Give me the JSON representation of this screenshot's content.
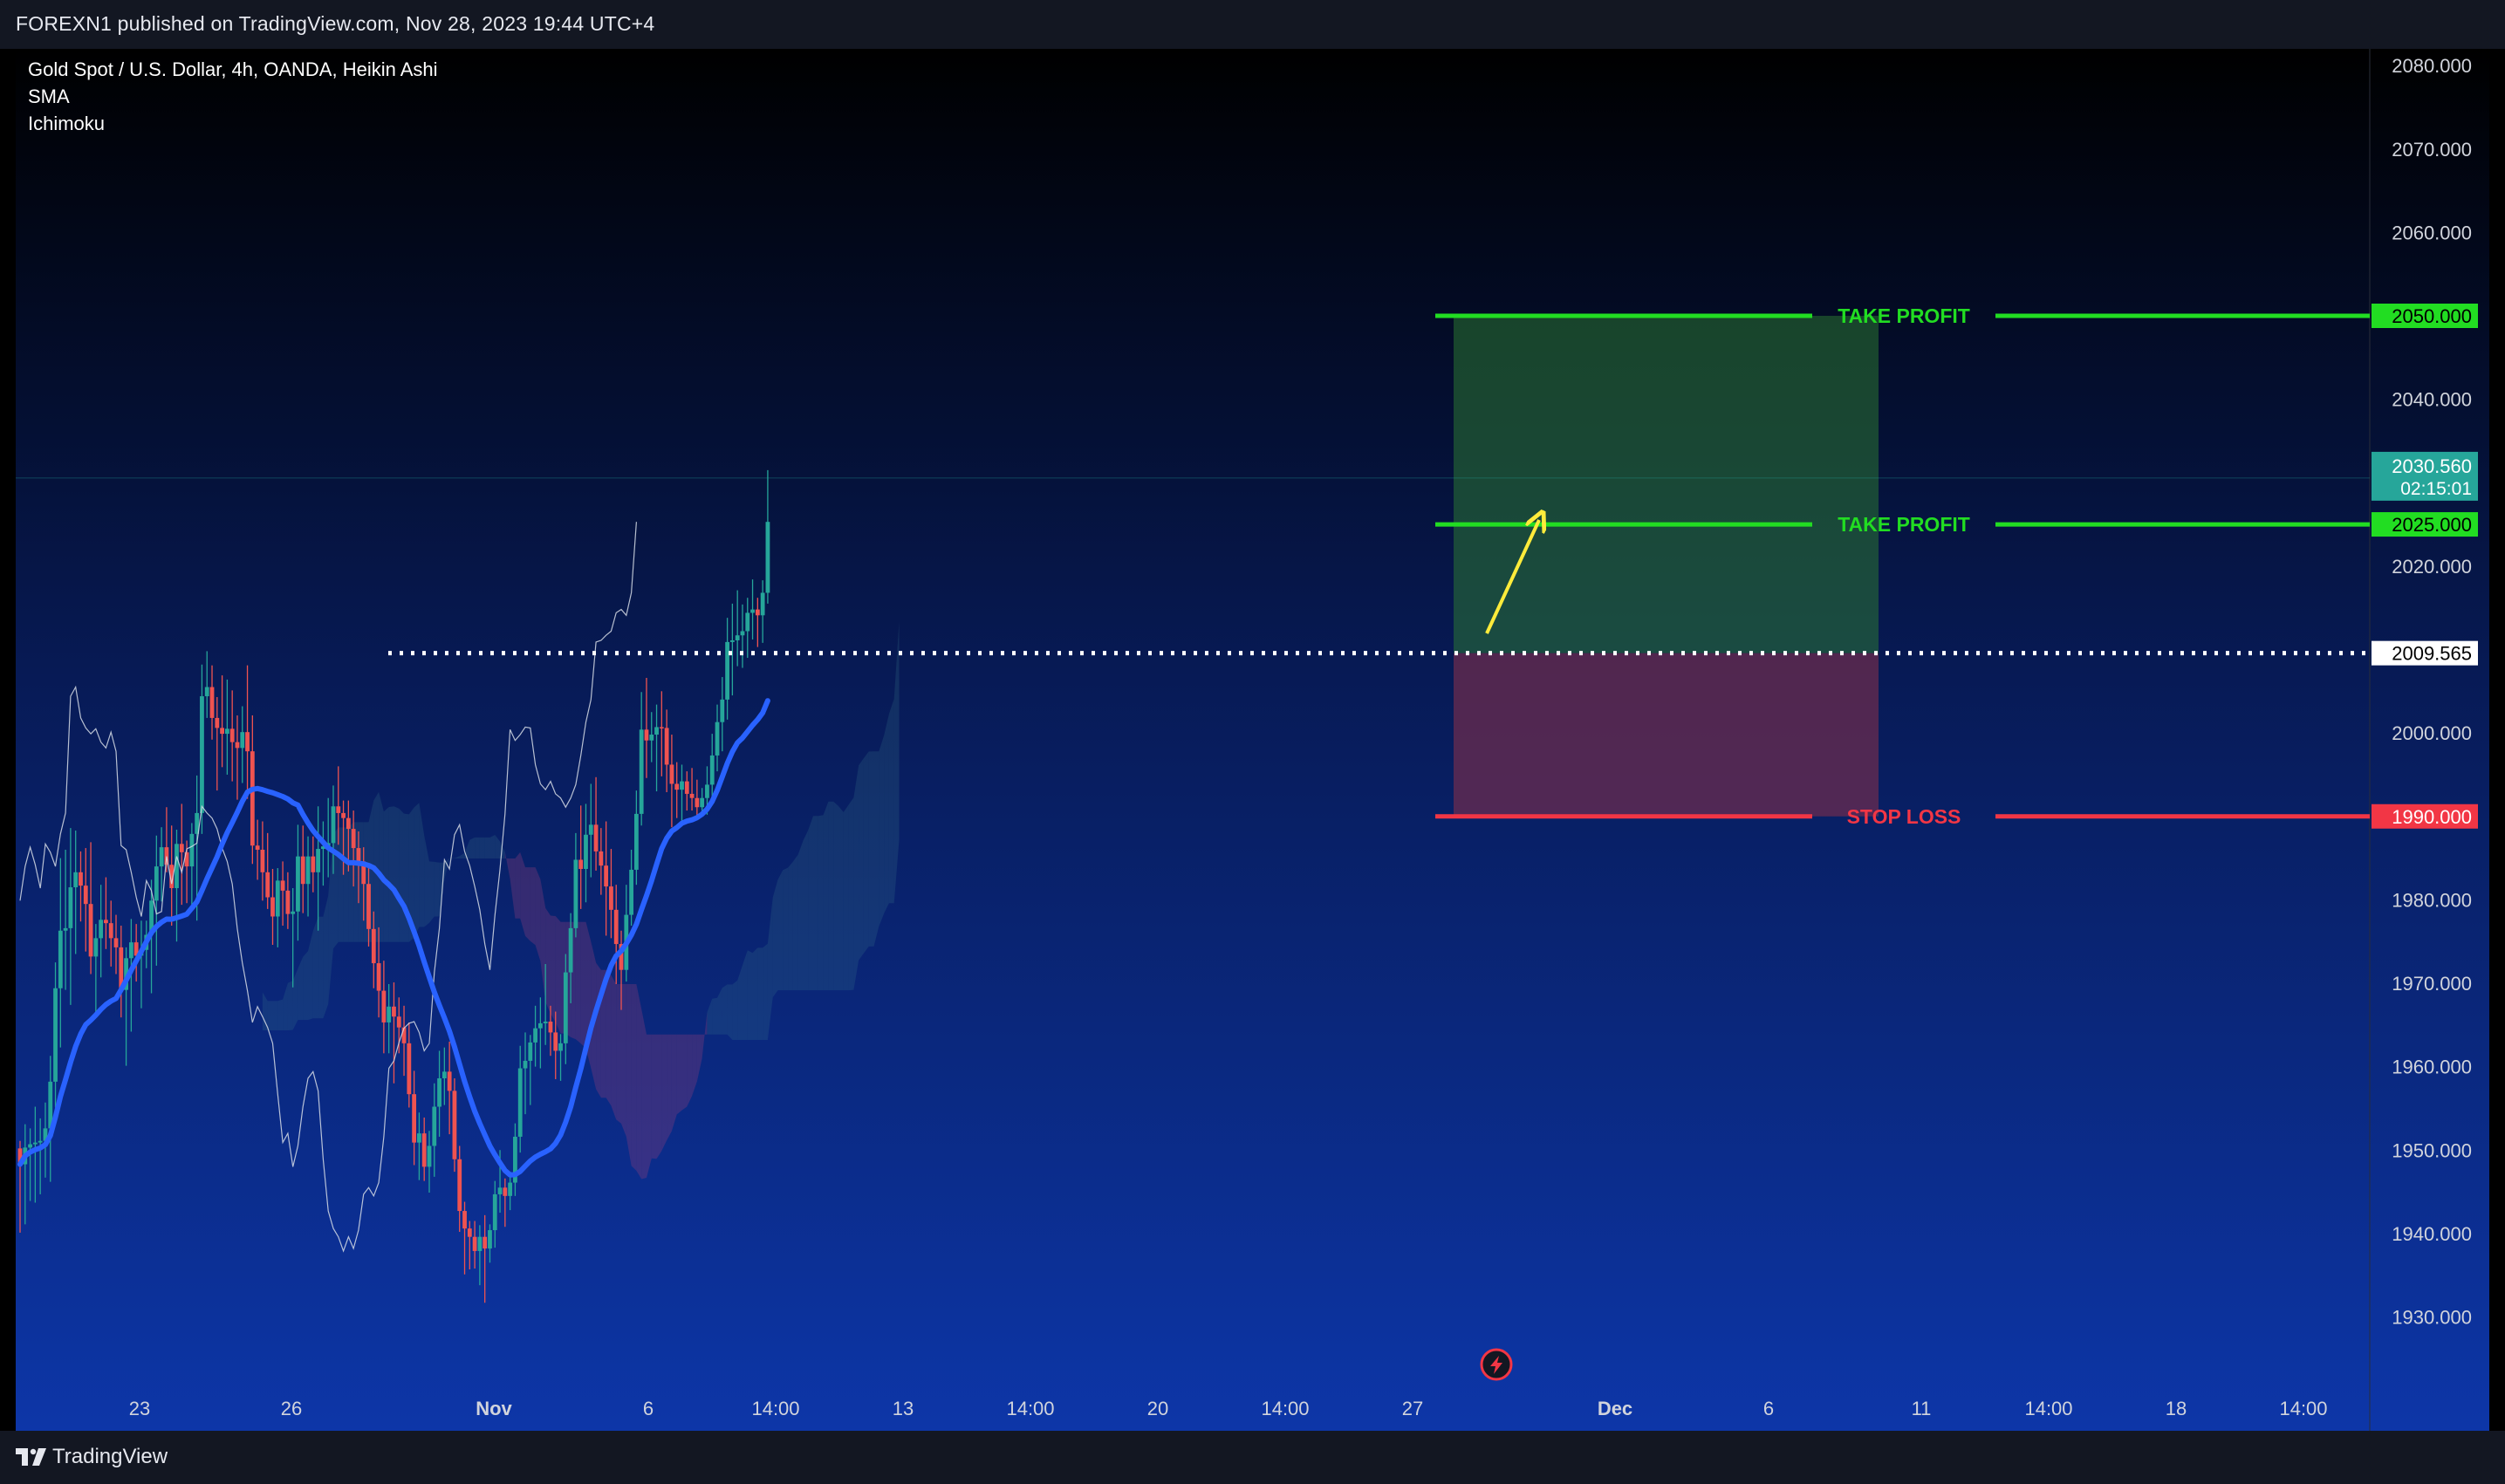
{
  "header": {
    "text": "FOREXN1 published on TradingView.com, Nov 28, 2023 19:44 UTC+4"
  },
  "footer": {
    "brand": "TradingView"
  },
  "legend": {
    "symbol": "Gold Spot / U.S. Dollar, 4h, OANDA, Heikin Ashi",
    "indicator_1": "SMA",
    "indicator_2": "Ichimoku"
  },
  "colors": {
    "background_top": "#000000",
    "background_bottom": "#0d34a6",
    "up_candle": "#26a69a",
    "down_candle": "#ef5350",
    "sma_line": "#2962ff",
    "ichimoku_line": "#d7dde6",
    "take_profit": "#22dd22",
    "stop_loss": "#f23645",
    "profit_zone": "#2e7d32",
    "loss_zone": "#7a2e4d",
    "arrow": "#ffeb3b",
    "entry_line": "#ffffff"
  },
  "chart_data": {
    "type": "candlestick",
    "ylim": [
      1922,
      2082
    ],
    "y_ticks": [
      "2080.000",
      "2070.000",
      "2060.000",
      "2050.000",
      "2040.000",
      "2030.000",
      "2020.000",
      "2010.000",
      "2000.000",
      "1990.000",
      "1980.000",
      "1970.000",
      "1960.000",
      "1950.000",
      "1940.000",
      "1930.000"
    ],
    "x_ticks": [
      "23",
      "26",
      "Nov",
      "6",
      "14:00",
      "13",
      "14:00",
      "20",
      "14:00",
      "27",
      "Dec",
      "6",
      "11",
      "14:00",
      "18",
      "14:00"
    ],
    "price_levels": [
      {
        "label": "TAKE PROFIT",
        "value": 2050.0,
        "display": "2050.000",
        "kind": "take_profit"
      },
      {
        "label": "TAKE PROFIT",
        "value": 2025.0,
        "display": "2025.000",
        "kind": "take_profit"
      },
      {
        "label": "",
        "value": 2009.565,
        "display": "2009.565",
        "kind": "entry"
      },
      {
        "label": "STOP LOSS",
        "value": 1990.0,
        "display": "1990.000",
        "kind": "stop_loss"
      }
    ],
    "current_price": {
      "value": 2030.56,
      "display": "2030.560",
      "countdown": "02:15:01"
    },
    "ohlc": [
      [
        1950.2,
        1951.1,
        1940.1,
        1948.3
      ],
      [
        1948.3,
        1953.1,
        1941.1,
        1950.3
      ],
      [
        1950.3,
        1952.6,
        1943.9,
        1950.7
      ],
      [
        1950.7,
        1955.2,
        1943.7,
        1950.9
      ],
      [
        1950.9,
        1953.8,
        1944.7,
        1951.1
      ],
      [
        1951.1,
        1955.7,
        1946.7,
        1952.6
      ],
      [
        1952.6,
        1961.3,
        1946.2,
        1958.2
      ],
      [
        1958.2,
        1972.5,
        1955.1,
        1969.4
      ],
      [
        1969.4,
        1985.0,
        1962.3,
        1976.3
      ],
      [
        1976.3,
        1986.0,
        1969.2,
        1976.6
      ],
      [
        1976.6,
        1988.6,
        1967.4,
        1981.5
      ],
      [
        1981.5,
        1988.3,
        1973.5,
        1983.3
      ],
      [
        1983.3,
        1985.8,
        1977.4,
        1981.7
      ],
      [
        1981.7,
        1986.2,
        1973.8,
        1979.5
      ],
      [
        1979.5,
        1986.9,
        1971.1,
        1973.2
      ],
      [
        1973.2,
        1977.1,
        1966.2,
        1975.4
      ],
      [
        1975.4,
        1981.8,
        1970.7,
        1977.6
      ],
      [
        1977.6,
        1982.7,
        1974.1,
        1977.2
      ],
      [
        1977.2,
        1979.9,
        1972.0,
        1975.4
      ],
      [
        1975.4,
        1978.2,
        1971.1,
        1974.3
      ],
      [
        1974.3,
        1976.9,
        1965.9,
        1969.2
      ],
      [
        1969.2,
        1974.3,
        1960.1,
        1973.0
      ],
      [
        1973.0,
        1977.7,
        1964.2,
        1974.9
      ],
      [
        1974.9,
        1977.1,
        1970.2,
        1973.3
      ],
      [
        1973.3,
        1977.5,
        1967.0,
        1974.0
      ],
      [
        1974.0,
        1977.5,
        1971.8,
        1975.8
      ],
      [
        1975.8,
        1982.4,
        1968.8,
        1979.9
      ],
      [
        1979.9,
        1987.7,
        1972.1,
        1984.0
      ],
      [
        1984.0,
        1988.7,
        1979.8,
        1986.3
      ],
      [
        1986.3,
        1991.1,
        1983.3,
        1984.2
      ],
      [
        1984.2,
        1988.9,
        1976.9,
        1981.4
      ],
      [
        1981.4,
        1988.4,
        1975.0,
        1986.7
      ],
      [
        1986.7,
        1991.5,
        1979.4,
        1985.7
      ],
      [
        1985.7,
        1987.1,
        1979.6,
        1984.0
      ],
      [
        1984.0,
        1989.2,
        1979.2,
        1987.9
      ],
      [
        1987.9,
        1994.9,
        1977.5,
        1990.4
      ],
      [
        1990.4,
        2008.2,
        1987.9,
        2004.4
      ],
      [
        2004.4,
        2009.8,
        2001.8,
        2005.5
      ],
      [
        2005.5,
        2008.1,
        1999.2,
        2001.8
      ],
      [
        2001.8,
        2004.3,
        1993.1,
        2000.6
      ],
      [
        2000.6,
        2006.9,
        1995.9,
        1999.9
      ],
      [
        1999.9,
        2006.4,
        1995.0,
        2000.5
      ],
      [
        2000.5,
        2005.1,
        1994.2,
        1998.9
      ],
      [
        1998.9,
        2002.1,
        1992.0,
        1998.2
      ],
      [
        1998.2,
        2003.2,
        1994.0,
        2000.1
      ],
      [
        2000.1,
        2008.1,
        1992.1,
        1997.8
      ],
      [
        1997.8,
        2002.1,
        1984.3,
        1986.5
      ],
      [
        1986.5,
        1989.6,
        1982.4,
        1986.0
      ],
      [
        1986.0,
        1989.4,
        1979.9,
        1983.3
      ],
      [
        1983.3,
        1988.0,
        1978.9,
        1980.3
      ],
      [
        1980.3,
        1983.7,
        1974.6,
        1978.0
      ],
      [
        1978.0,
        1983.8,
        1974.3,
        1982.3
      ],
      [
        1982.3,
        1984.6,
        1976.9,
        1981.1
      ],
      [
        1981.1,
        1983.3,
        1976.5,
        1978.3
      ],
      [
        1978.3,
        1981.4,
        1969.5,
        1978.6
      ],
      [
        1978.6,
        1989.0,
        1975.1,
        1985.2
      ],
      [
        1985.2,
        1988.9,
        1978.4,
        1981.9
      ],
      [
        1981.9,
        1987.6,
        1978.0,
        1985.2
      ],
      [
        1985.2,
        1987.6,
        1980.9,
        1983.3
      ],
      [
        1983.3,
        1991.2,
        1976.3,
        1986.1
      ],
      [
        1986.1,
        1989.4,
        1981.7,
        1986.4
      ],
      [
        1986.4,
        1992.2,
        1982.7,
        1986.8
      ],
      [
        1986.8,
        1993.7,
        1983.1,
        1991.2
      ],
      [
        1991.2,
        1996.0,
        1986.6,
        1990.4
      ],
      [
        1990.4,
        1991.9,
        1983.0,
        1989.8
      ],
      [
        1989.8,
        1991.9,
        1983.4,
        1988.5
      ],
      [
        1988.5,
        1990.7,
        1981.6,
        1986.2
      ],
      [
        1986.2,
        1988.2,
        1979.6,
        1984.6
      ],
      [
        1984.6,
        1986.3,
        1977.5,
        1981.9
      ],
      [
        1981.9,
        1984.4,
        1974.4,
        1976.5
      ],
      [
        1976.5,
        1978.6,
        1969.4,
        1972.4
      ],
      [
        1972.4,
        1976.7,
        1965.9,
        1969.1
      ],
      [
        1969.1,
        1972.7,
        1961.6,
        1965.3
      ],
      [
        1965.3,
        1969.9,
        1961.6,
        1967.2
      ],
      [
        1967.2,
        1970.1,
        1958.0,
        1966.0
      ],
      [
        1966.0,
        1968.3,
        1961.6,
        1964.7
      ],
      [
        1964.7,
        1967.3,
        1958.9,
        1962.8
      ],
      [
        1962.8,
        1965.3,
        1955.1,
        1956.7
      ],
      [
        1956.7,
        1959.5,
        1948.2,
        1950.9
      ],
      [
        1950.9,
        1954.5,
        1946.4,
        1952.0
      ],
      [
        1952.0,
        1953.9,
        1946.3,
        1948.0
      ],
      [
        1948.0,
        1952.3,
        1944.9,
        1950.5
      ],
      [
        1950.5,
        1958.0,
        1946.8,
        1955.2
      ],
      [
        1955.2,
        1961.9,
        1951.6,
        1958.6
      ],
      [
        1958.6,
        1962.3,
        1955.4,
        1959.4
      ],
      [
        1959.4,
        1963.0,
        1951.9,
        1957.1
      ],
      [
        1957.1,
        1958.6,
        1947.4,
        1948.9
      ],
      [
        1948.9,
        1950.5,
        1940.2,
        1942.7
      ],
      [
        1942.7,
        1943.8,
        1935.1,
        1940.6
      ],
      [
        1940.6,
        1941.5,
        1935.7,
        1939.6
      ],
      [
        1939.6,
        1941.5,
        1935.8,
        1937.9
      ],
      [
        1937.9,
        1941.0,
        1933.8,
        1939.6
      ],
      [
        1939.6,
        1942.2,
        1931.7,
        1938.2
      ],
      [
        1938.2,
        1941.1,
        1936.5,
        1940.4
      ],
      [
        1940.4,
        1946.3,
        1938.3,
        1944.7
      ],
      [
        1944.7,
        1950.0,
        1942.5,
        1945.5
      ],
      [
        1945.5,
        1946.6,
        1940.8,
        1944.5
      ],
      [
        1944.5,
        1947.4,
        1942.8,
        1946.1
      ],
      [
        1946.1,
        1953.2,
        1944.5,
        1951.6
      ],
      [
        1951.6,
        1962.5,
        1949.7,
        1959.8
      ],
      [
        1959.8,
        1964.1,
        1954.3,
        1960.7
      ],
      [
        1960.7,
        1963.8,
        1955.4,
        1962.9
      ],
      [
        1962.9,
        1967.3,
        1960.0,
        1964.6
      ],
      [
        1964.6,
        1968.3,
        1959.8,
        1965.2
      ],
      [
        1965.2,
        1972.3,
        1962.6,
        1965.4
      ],
      [
        1965.4,
        1967.3,
        1961.3,
        1964.1
      ],
      [
        1964.1,
        1966.6,
        1958.5,
        1961.9
      ],
      [
        1961.9,
        1963.9,
        1958.3,
        1962.8
      ],
      [
        1962.8,
        1973.5,
        1960.3,
        1971.3
      ],
      [
        1971.3,
        1978.4,
        1967.6,
        1976.6
      ],
      [
        1976.6,
        1988.0,
        1975.5,
        1984.8
      ],
      [
        1984.8,
        1991.3,
        1978.9,
        1983.7
      ],
      [
        1983.7,
        1991.5,
        1979.7,
        1987.8
      ],
      [
        1987.8,
        1993.9,
        1982.7,
        1989.0
      ],
      [
        1989.0,
        1994.7,
        1983.5,
        1985.8
      ],
      [
        1985.8,
        1988.6,
        1980.6,
        1984.1
      ],
      [
        1984.1,
        1989.4,
        1975.7,
        1981.6
      ],
      [
        1981.6,
        1986.1,
        1975.4,
        1978.8
      ],
      [
        1978.8,
        1981.8,
        1969.9,
        1974.7
      ],
      [
        1974.7,
        1976.3,
        1966.8,
        1971.6
      ],
      [
        1971.6,
        1981.8,
        1970.2,
        1978.2
      ],
      [
        1978.2,
        1986.0,
        1976.9,
        1983.6
      ],
      [
        1983.6,
        1993.1,
        1981.8,
        1990.3
      ],
      [
        1990.3,
        2004.9,
        1988.9,
        2000.4
      ],
      [
        2000.4,
        2006.6,
        1994.6,
        1999.1
      ],
      [
        1999.1,
        2002.5,
        1996.5,
        1999.8
      ],
      [
        1999.8,
        2003.4,
        1993.0,
        2000.7
      ],
      [
        2000.7,
        2005.0,
        1994.8,
        2000.6
      ],
      [
        2000.6,
        2002.8,
        1992.9,
        1996.2
      ],
      [
        1996.2,
        1999.8,
        1988.7,
        1993.9
      ],
      [
        1993.9,
        1996.5,
        1989.8,
        1993.2
      ],
      [
        1993.2,
        1996.2,
        1988.8,
        1994.2
      ],
      [
        1994.2,
        1995.4,
        1990.7,
        1992.7
      ],
      [
        1992.7,
        1995.8,
        1990.7,
        1992.2
      ],
      [
        1992.2,
        1994.4,
        1990.1,
        1991.1
      ],
      [
        1991.1,
        1993.4,
        1990.4,
        1992.2
      ],
      [
        1992.2,
        1996.0,
        1990.2,
        1993.8
      ],
      [
        1993.8,
        1999.9,
        1991.7,
        1997.3
      ],
      [
        1997.3,
        2003.4,
        1995.4,
        2001.3
      ],
      [
        2001.3,
        2006.7,
        1997.8,
        2004.0
      ],
      [
        2004.0,
        2013.8,
        2001.6,
        2010.9
      ],
      [
        2010.9,
        2015.5,
        2004.5,
        2011.1
      ],
      [
        2011.1,
        2017.1,
        2008.0,
        2011.7
      ],
      [
        2011.7,
        2015.4,
        2007.8,
        2012.2
      ],
      [
        2012.2,
        2016.2,
        2009.0,
        2014.4
      ],
      [
        2014.4,
        2018.4,
        2011.2,
        2014.8
      ],
      [
        2014.8,
        2016.2,
        2010.3,
        2014.1
      ],
      [
        2014.1,
        2018.3,
        2010.8,
        2016.8
      ],
      [
        2016.8,
        2031.5,
        2015.5,
        2025.3
      ]
    ]
  }
}
